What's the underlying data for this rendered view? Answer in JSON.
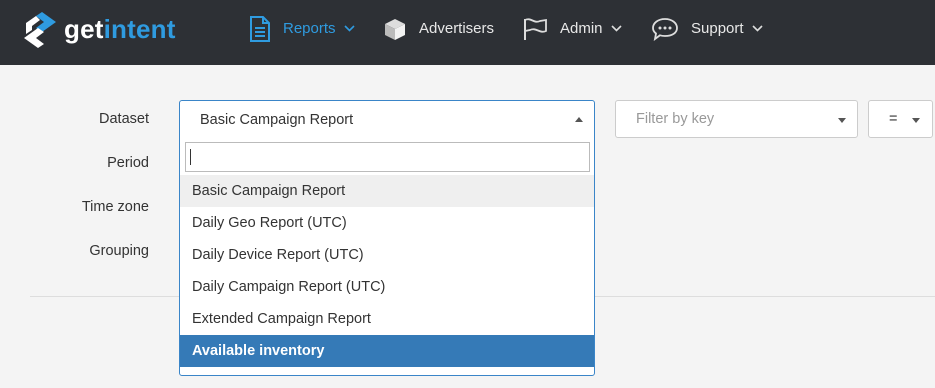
{
  "brand": {
    "name_part1": "get",
    "name_part2": "intent"
  },
  "nav": [
    {
      "label": "Reports",
      "icon": "document-icon",
      "active": true,
      "dropdown": true
    },
    {
      "label": "Advertisers",
      "icon": "box-icon",
      "active": false,
      "dropdown": false
    },
    {
      "label": "Admin",
      "icon": "flag-icon",
      "active": false,
      "dropdown": true
    },
    {
      "label": "Support",
      "icon": "chat-bubble-icon",
      "active": false,
      "dropdown": true
    }
  ],
  "form": {
    "labels": {
      "dataset": "Dataset",
      "period": "Period",
      "timezone": "Time zone",
      "grouping": "Grouping"
    },
    "dataset": {
      "selected": "Basic Campaign Report",
      "search_value": "",
      "options": [
        "Basic Campaign Report",
        "Daily Geo Report (UTC)",
        "Daily Device Report (UTC)",
        "Daily Campaign Report (UTC)",
        "Extended Campaign Report",
        "Available inventory"
      ],
      "hovered_option": "Basic Campaign Report",
      "highlighted_option": "Available inventory"
    },
    "filter": {
      "placeholder": "Filter by key"
    },
    "operator": {
      "value": "="
    }
  },
  "colors": {
    "topbar": "#2d3035",
    "accent": "#2f9be0",
    "highlight": "#357ab7",
    "background": "#f4f4f4"
  }
}
